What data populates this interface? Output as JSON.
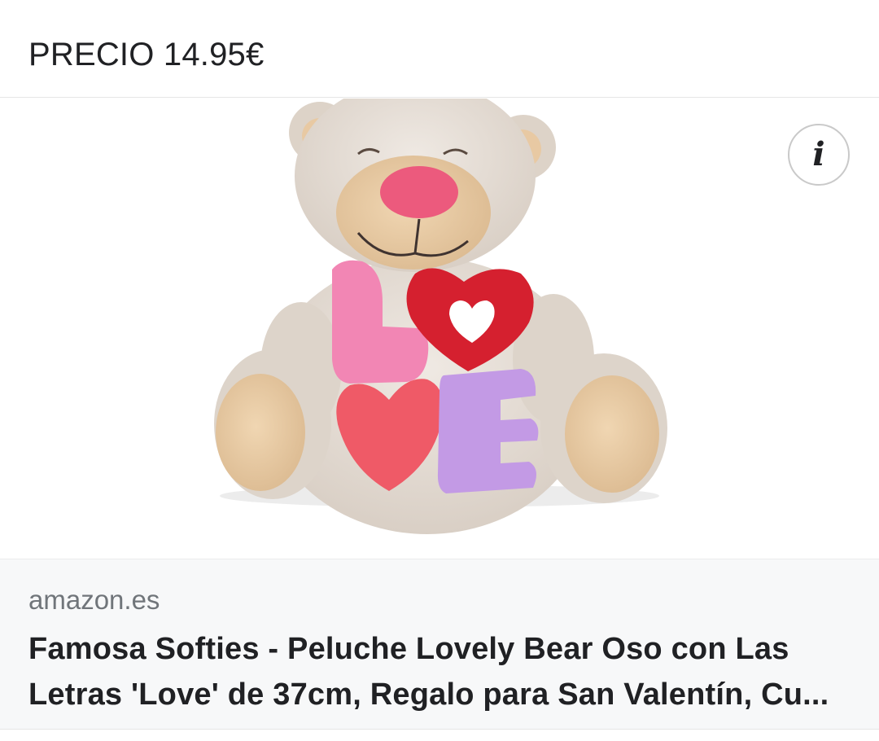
{
  "header": {
    "price_text": "PRECIO 14.95€"
  },
  "image": {
    "subject": "teddy bear plush holding LOVE letters",
    "letters": [
      "L",
      "O",
      "V",
      "E"
    ],
    "colors": {
      "fur": "#e6dfd7",
      "muzzle": "#e7c9a3",
      "nose": "#ec5a7d",
      "letter_L": "#f286b4",
      "letter_O": "#d5202f",
      "letter_V": "#ef5a67",
      "letter_E": "#c39ae5"
    }
  },
  "info_button": {
    "glyph": "i",
    "icon": "info-icon"
  },
  "result": {
    "source": "amazon.es",
    "title_line1": "Famosa Softies - Peluche Lovely Bear Oso con Las",
    "title_line2": "Letras 'Love' de 37cm, Regalo para San Valentín, Cu..."
  }
}
